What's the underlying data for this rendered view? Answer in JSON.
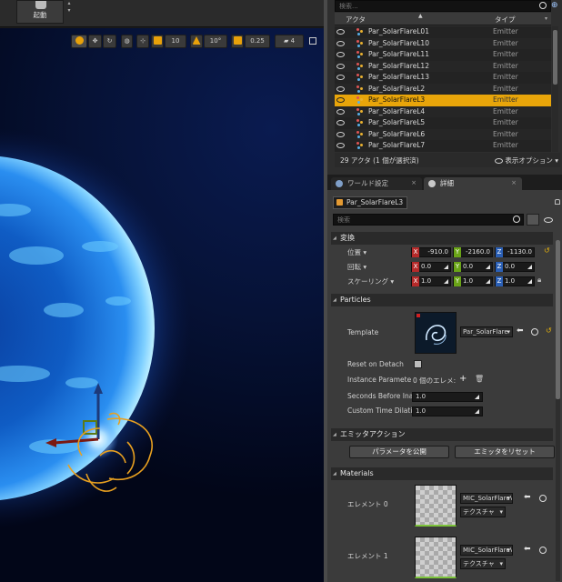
{
  "toolbar": {
    "launch_label": "起動"
  },
  "viewport_tools": {
    "grid_snap": "10",
    "rotation_snap": "10°",
    "scale_snap": "0.25",
    "camera_speed": "4"
  },
  "outliner": {
    "search_placeholder": "検索...",
    "col_actor": "アクタ",
    "col_type": "タイプ",
    "rows": [
      {
        "name": "Par_SolarFlareL01",
        "type": "Emitter"
      },
      {
        "name": "Par_SolarFlareL10",
        "type": "Emitter"
      },
      {
        "name": "Par_SolarFlareL11",
        "type": "Emitter"
      },
      {
        "name": "Par_SolarFlareL12",
        "type": "Emitter"
      },
      {
        "name": "Par_SolarFlareL13",
        "type": "Emitter"
      },
      {
        "name": "Par_SolarFlareL2",
        "type": "Emitter"
      },
      {
        "name": "Par_SolarFlareL3",
        "type": "Emitter"
      },
      {
        "name": "Par_SolarFlareL4",
        "type": "Emitter"
      },
      {
        "name": "Par_SolarFlareL5",
        "type": "Emitter"
      },
      {
        "name": "Par_SolarFlareL6",
        "type": "Emitter"
      },
      {
        "name": "Par_SolarFlareL7",
        "type": "Emitter"
      }
    ],
    "selected_index": 6,
    "count_text": "29 アクタ (1 個が選択済)",
    "view_options": "表示オプション"
  },
  "tabs": {
    "world": "ワールド設定",
    "details": "詳細"
  },
  "details": {
    "actor_name": "Par_SolarFlareL3",
    "search_placeholder": "検索",
    "transform": {
      "section": "変換",
      "location_label": "位置",
      "rotation_label": "回転",
      "scale_label": "スケーリング",
      "location": [
        "-910.0",
        "-2160.0",
        "-1130.0"
      ],
      "rotation": [
        "0.0",
        "0.0",
        "0.0"
      ],
      "scale": [
        "1.0",
        "1.0",
        "1.0"
      ]
    },
    "particles": {
      "section": "Particles",
      "template_label": "Template",
      "template_value": "Par_SolarFlare",
      "reset_on_detach": "Reset on Detach",
      "instance_params": "Instance Paramete",
      "instance_params_value": "0 個のエレメ:",
      "seconds_before": "Seconds Before Ina",
      "seconds_before_value": "1.0",
      "custom_time": "Custom Time Dilati",
      "custom_time_value": "1.0"
    },
    "emitter_actions": {
      "section": "エミッタアクション",
      "publish_btn": "パラメータを公開",
      "reset_btn": "エミッタをリセット"
    },
    "materials": {
      "section": "Materials",
      "element0": "エレメント 0",
      "element1": "エレメント 1",
      "mat0": "MIC_SolarFlareV",
      "mat1": "MIC_SolarFlareV",
      "texture": "テクスチャ"
    }
  }
}
